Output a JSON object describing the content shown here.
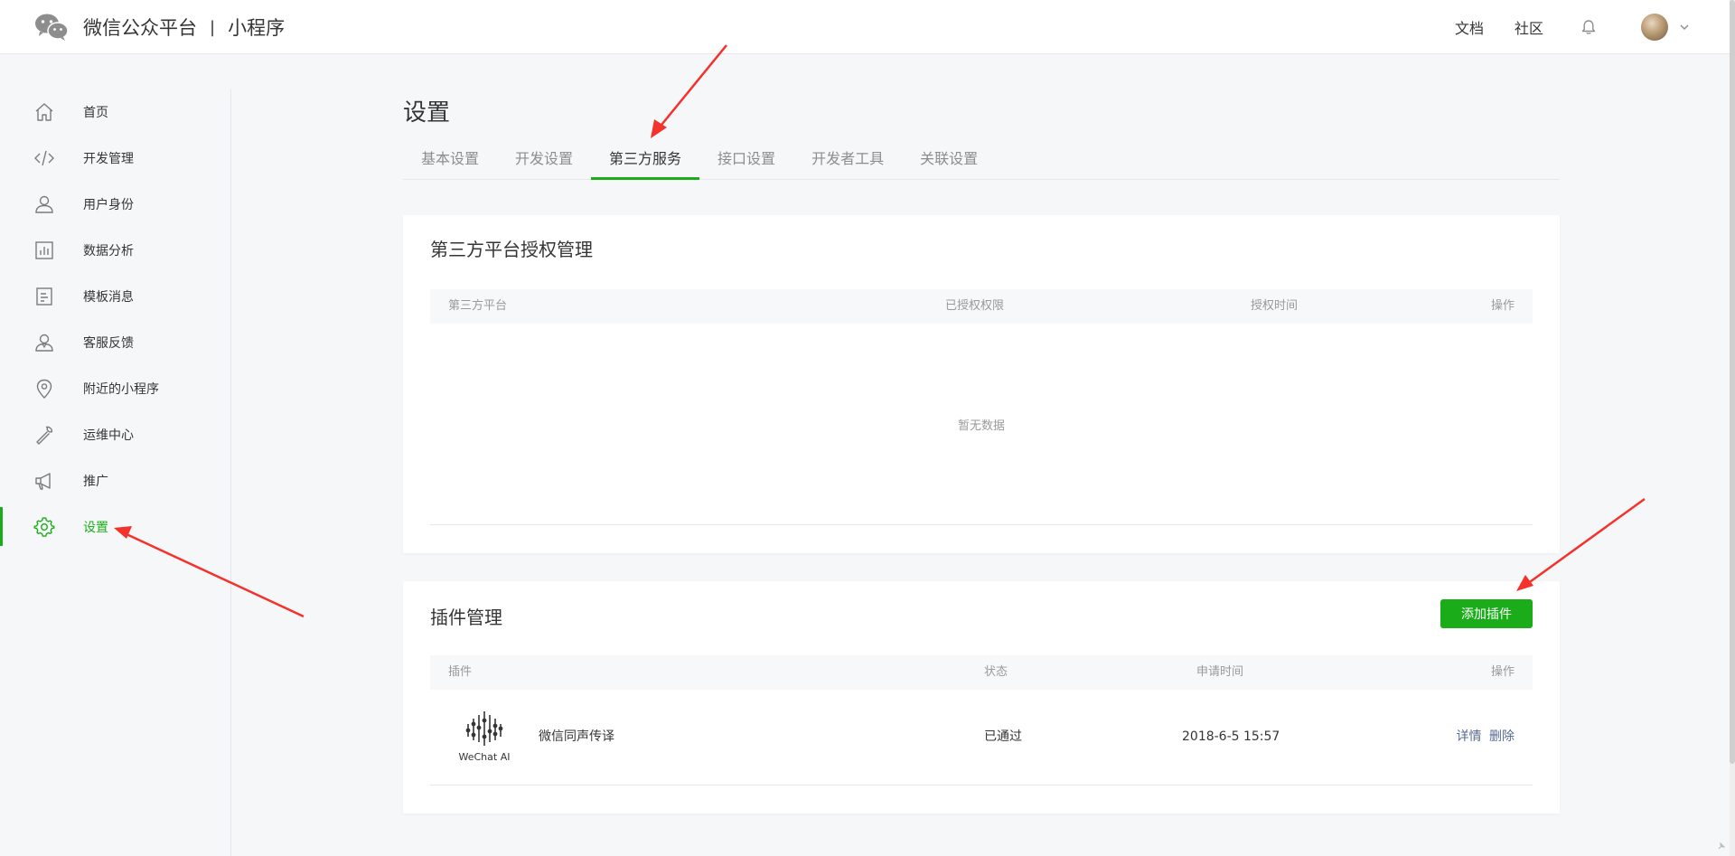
{
  "header": {
    "brand_name": "微信公众平台",
    "separator": "|",
    "brand_sub": "小程序",
    "links": [
      "文档",
      "社区"
    ],
    "icons": [
      "wechat-logo-icon",
      "bell-icon",
      "avatar",
      "chevron-down-icon"
    ]
  },
  "sidebar": {
    "items": [
      {
        "label": "首页",
        "icon": "home-icon"
      },
      {
        "label": "开发管理",
        "icon": "code-icon"
      },
      {
        "label": "用户身份",
        "icon": "user-icon"
      },
      {
        "label": "数据分析",
        "icon": "chart-icon"
      },
      {
        "label": "模板消息",
        "icon": "document-icon"
      },
      {
        "label": "客服反馈",
        "icon": "customer-service-icon"
      },
      {
        "label": "附近的小程序",
        "icon": "location-pin-icon"
      },
      {
        "label": "运维中心",
        "icon": "wrench-icon"
      },
      {
        "label": "推广",
        "icon": "megaphone-icon"
      },
      {
        "label": "设置",
        "icon": "gear-icon",
        "active": true
      }
    ]
  },
  "main": {
    "title": "设置",
    "tabs": [
      {
        "label": "基本设置"
      },
      {
        "label": "开发设置"
      },
      {
        "label": "第三方服务",
        "active": true
      },
      {
        "label": "接口设置"
      },
      {
        "label": "开发者工具"
      },
      {
        "label": "关联设置"
      }
    ],
    "third_party": {
      "title": "第三方平台授权管理",
      "columns": [
        "第三方平台",
        "已授权权限",
        "授权时间",
        "操作"
      ],
      "empty_text": "暂无数据"
    },
    "plugins": {
      "title": "插件管理",
      "add_button": "添加插件",
      "columns": [
        "插件",
        "状态",
        "申请时间",
        "操作"
      ],
      "rows": [
        {
          "logo_text": "WeChat AI",
          "name": "微信同声传译",
          "status": "已通过",
          "time": "2018-6-5 15:57",
          "actions": [
            "详情",
            "删除"
          ]
        }
      ]
    }
  },
  "colors": {
    "accent": "#1aad19",
    "link": "#576b95",
    "annotation_arrow": "#f5312c"
  }
}
